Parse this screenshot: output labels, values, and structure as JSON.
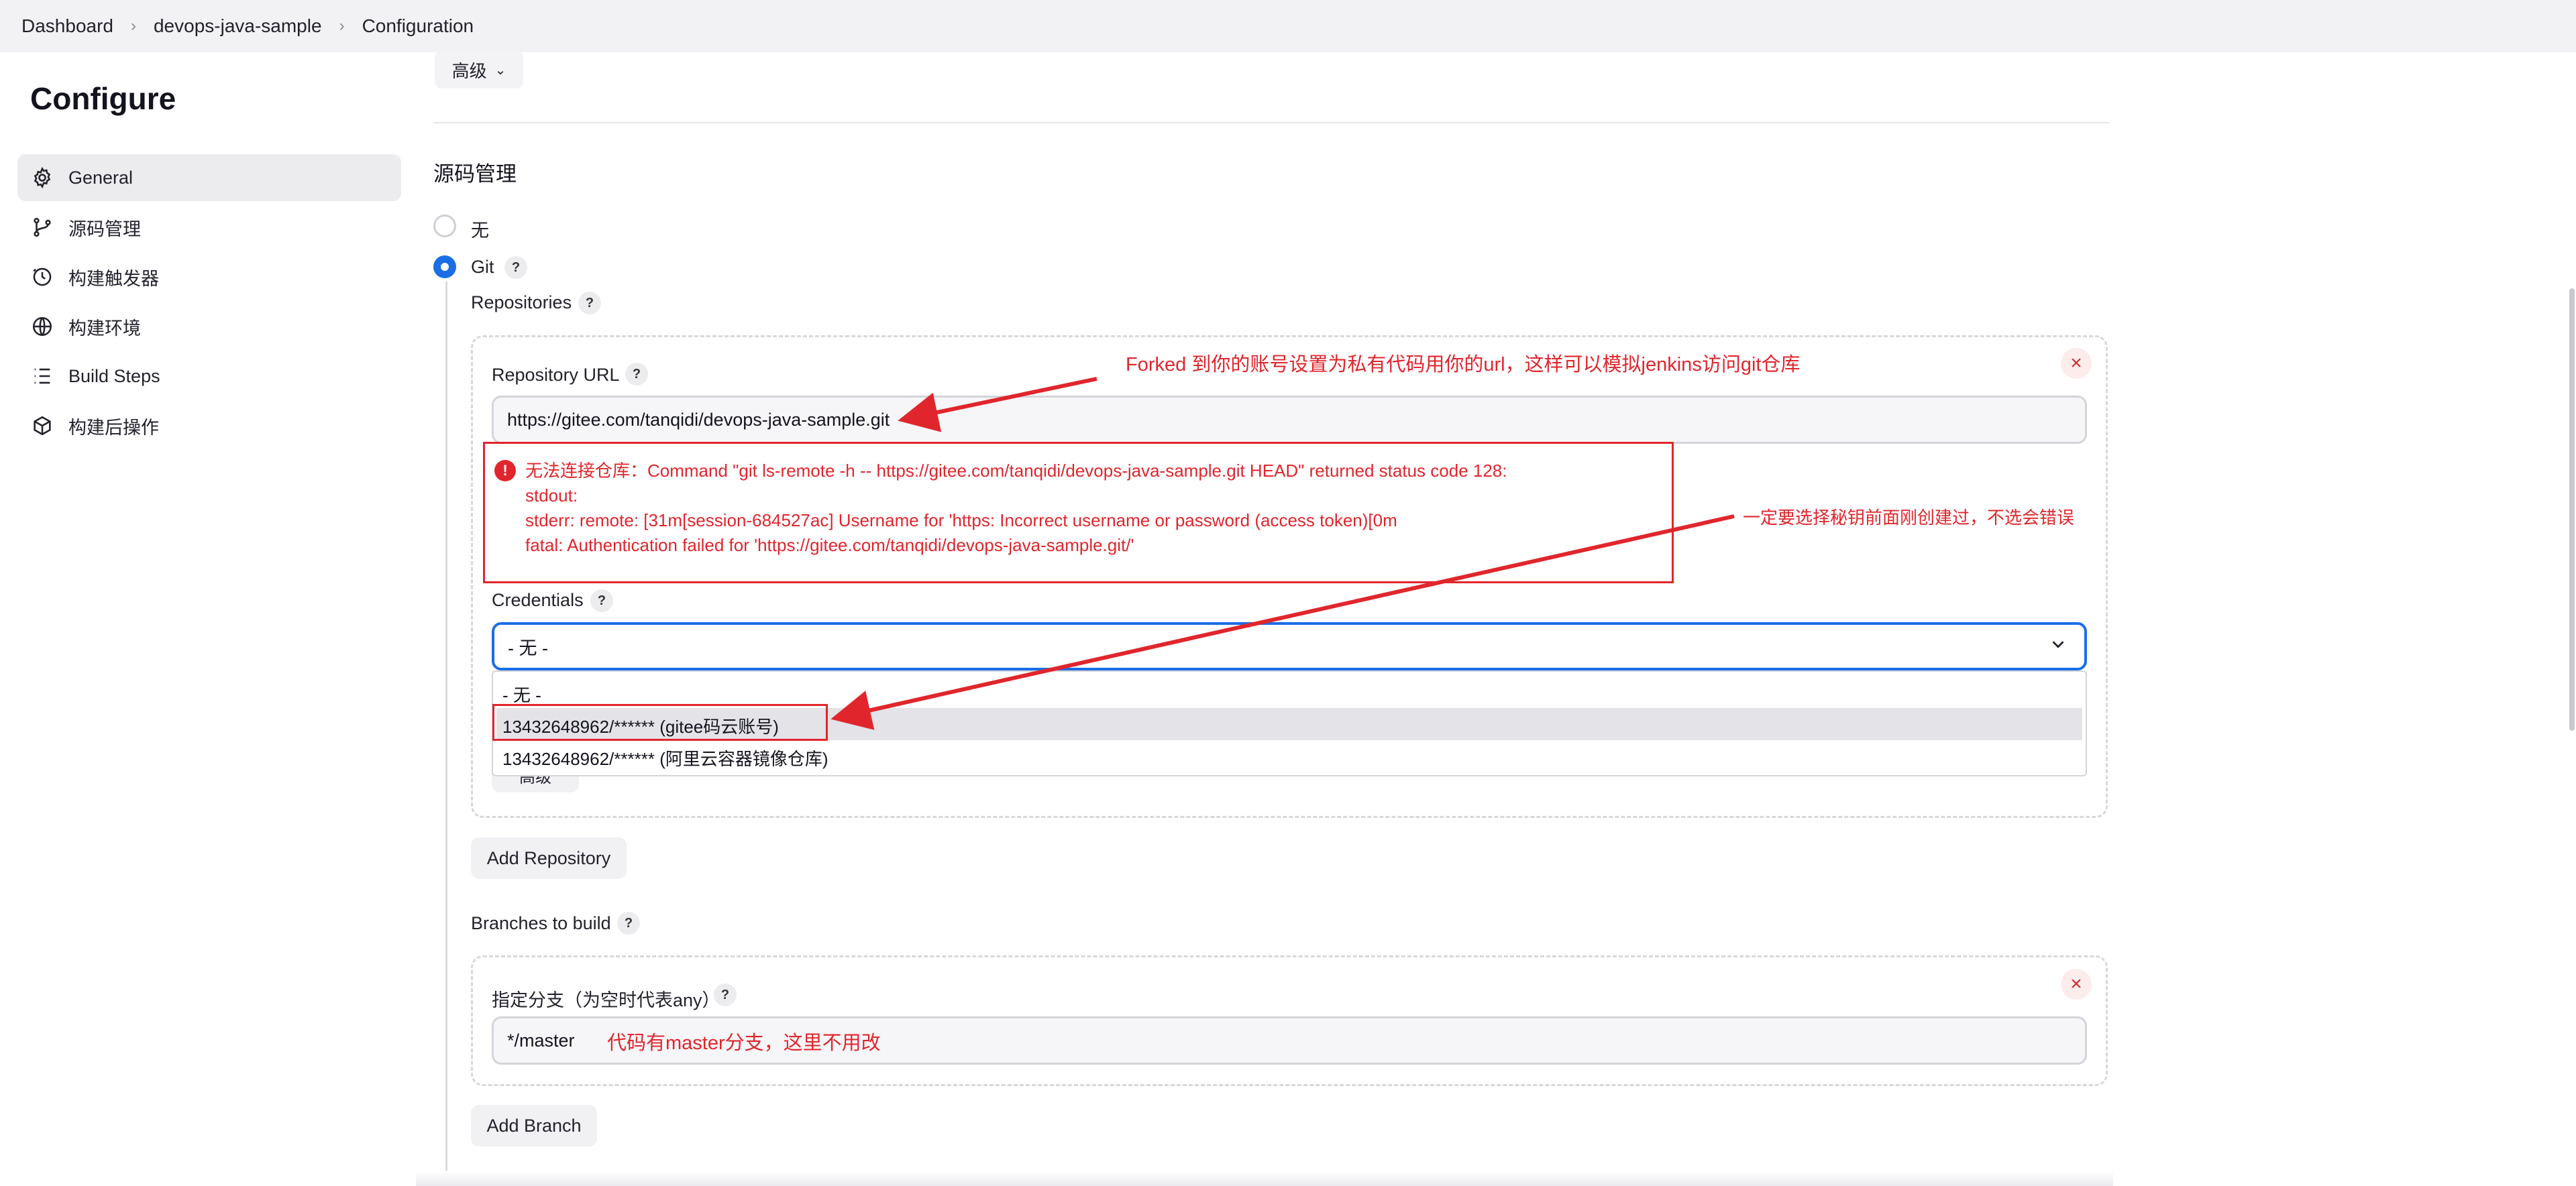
{
  "breadcrumb": {
    "items": [
      "Dashboard",
      "devops-java-sample",
      "Configuration"
    ]
  },
  "sidebar": {
    "title": "Configure",
    "items": [
      {
        "label": "General",
        "icon": "gear-icon",
        "active": true
      },
      {
        "label": "源码管理",
        "icon": "branch-icon",
        "active": false
      },
      {
        "label": "构建触发器",
        "icon": "clock-icon",
        "active": false
      },
      {
        "label": "构建环境",
        "icon": "globe-icon",
        "active": false
      },
      {
        "label": "Build Steps",
        "icon": "list-icon",
        "active": false
      },
      {
        "label": "构建后操作",
        "icon": "package-icon",
        "active": false
      }
    ]
  },
  "main": {
    "advanced_label": "高级",
    "section_title": "源码管理",
    "scm_options": {
      "none": "无",
      "git": "Git",
      "selected": "Git"
    },
    "repositories_label": "Repositories",
    "repo_url_label": "Repository URL",
    "repo_url_value": "https://gitee.com/tanqidi/devops-java-sample.git",
    "error": {
      "line1": "无法连接仓库：Command \"git ls-remote -h -- https://gitee.com/tanqidi/devops-java-sample.git HEAD\" returned status code 128:",
      "line2": "stdout:",
      "line3": "stderr: remote: [31m[session-684527ac] Username for 'https: Incorrect username or password (access token)[0m",
      "line4": "fatal: Authentication failed for 'https://gitee.com/tanqidi/devops-java-sample.git/'"
    },
    "credentials_label": "Credentials",
    "credentials_selected": "- 无 -",
    "credentials_options": [
      "- 无 -",
      "13432648962/****** (gitee码云账号)",
      "13432648962/****** (阿里云容器镜像仓库)"
    ],
    "hidden_advanced_label": "高级",
    "add_repository_label": "Add Repository",
    "branches_label": "Branches to build",
    "branch_specifier_label": "指定分支（为空时代表any）",
    "branch_value": "*/master",
    "add_branch_label": "Add Branch"
  },
  "annotations": {
    "url_note": "Forked 到你的账号设置为私有代码用你的url，这样可以模拟jenkins访问git仓库",
    "credential_note": "一定要选择秘钥前面刚创建过，不选会错误",
    "branch_note": "代码有master分支，这里不用改"
  },
  "colors": {
    "accent": "#1a6ee6",
    "annotation_red": "#e0262c",
    "active_nav_bg": "#ececef"
  }
}
